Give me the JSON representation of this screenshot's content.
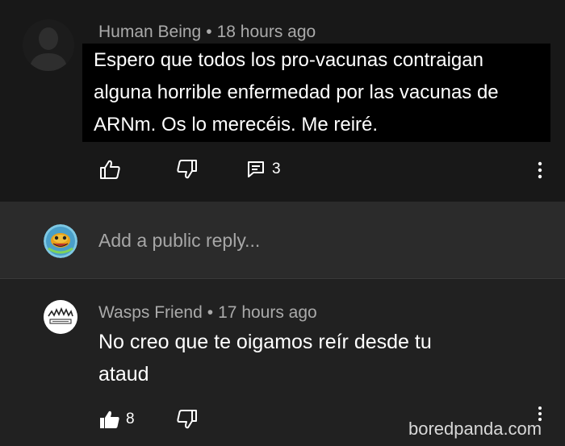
{
  "comment": {
    "author": "Human Being",
    "time": "18 hours ago",
    "bullet": "•",
    "text_lines": [
      "Espero que todos los pro-vacunas contraigan",
      "alguna horrible enfermedad por las vacunas de",
      "ARNm. Os lo merecéis. Me reiré."
    ],
    "reply_count": "3"
  },
  "reply_box": {
    "placeholder": "Add a public reply..."
  },
  "reply": {
    "author": "Wasps Friend",
    "time": "17 hours ago",
    "bullet": "•",
    "text_lines": [
      "No creo que te oigamos reír desde tu",
      "ataud"
    ],
    "like_count": "8"
  },
  "watermark": "boredpanda.com",
  "colors": {
    "background": "#1f1f1f",
    "highlight": "#000000",
    "meta_text": "#aaaaaa"
  }
}
